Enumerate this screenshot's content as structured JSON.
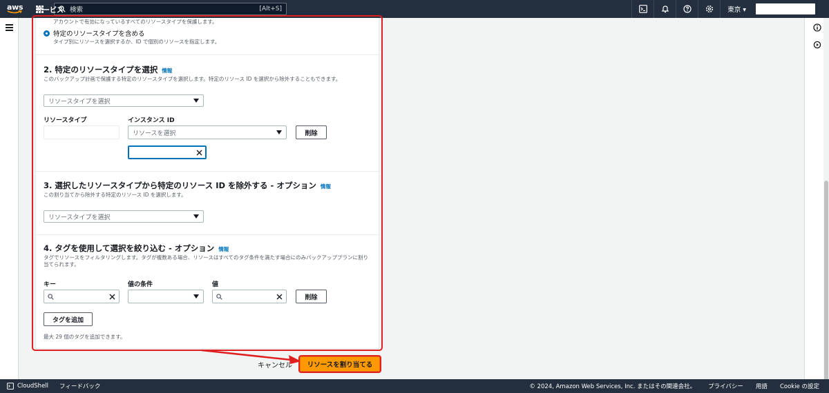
{
  "topnav": {
    "logo": "aws",
    "services_label": "サービス",
    "search_placeholder": "検索",
    "search_shortcut": "[Alt+S]",
    "region_label": "東京 ▾"
  },
  "section1": {
    "top_note": "アカウントで有効になっているすべてのリソースタイプを保護します。",
    "option_label": "特定のリソースタイプを含める",
    "option_desc": "タイプ別にリソースを選択するか、ID で個別のリソースを指定します。"
  },
  "section2": {
    "title": "2. 特定のリソースタイプを選択",
    "info": "情報",
    "desc": "このバックアップ計画で保護する特定のリソースタイプを選択します。特定のリソース ID を選択から除外することもできます。",
    "type_select_placeholder": "リソースタイプを選択",
    "col_resource_type": "リソースタイプ",
    "col_instance_id": "インスタンス ID",
    "resource_select_placeholder": "リソースを選択",
    "delete_label": "削除"
  },
  "section3": {
    "title": "3. 選択したリソースタイプから特定のリソース ID を除外する - オプション",
    "info": "情報",
    "desc": "この割り当てから除外する特定のリソース ID を選択します。",
    "type_select_placeholder": "リソースタイプを選択"
  },
  "section4": {
    "title": "4. タグを使用して選択を絞り込む - オプション",
    "info": "情報",
    "desc_line1": "タグでリソースをフィルタリングします。タグが複数ある場合、リソースはすべてのタグ条件を満たす場合にのみバックアッププランに割り",
    "desc_line2": "当てられます。",
    "col_key": "キー",
    "col_condition": "値の条件",
    "col_value": "値",
    "delete_label": "削除",
    "add_tag_label": "タグを追加",
    "limit_note": "最大 29 個のタグを追加できます。"
  },
  "actions": {
    "cancel_label": "キャンセル",
    "assign_label": "リソースを割り当てる"
  },
  "footer": {
    "cloudshell": "CloudShell",
    "feedback": "フィードバック",
    "copyright": "© 2024, Amazon Web Services, Inc. またはその関連会社。",
    "privacy": "プライバシー",
    "terms": "用語",
    "cookie": "Cookie の設定"
  },
  "colors": {
    "nav_bg": "#232f3e",
    "primary": "#ff9900",
    "link": "#0073bb",
    "highlight": "#e02020"
  }
}
